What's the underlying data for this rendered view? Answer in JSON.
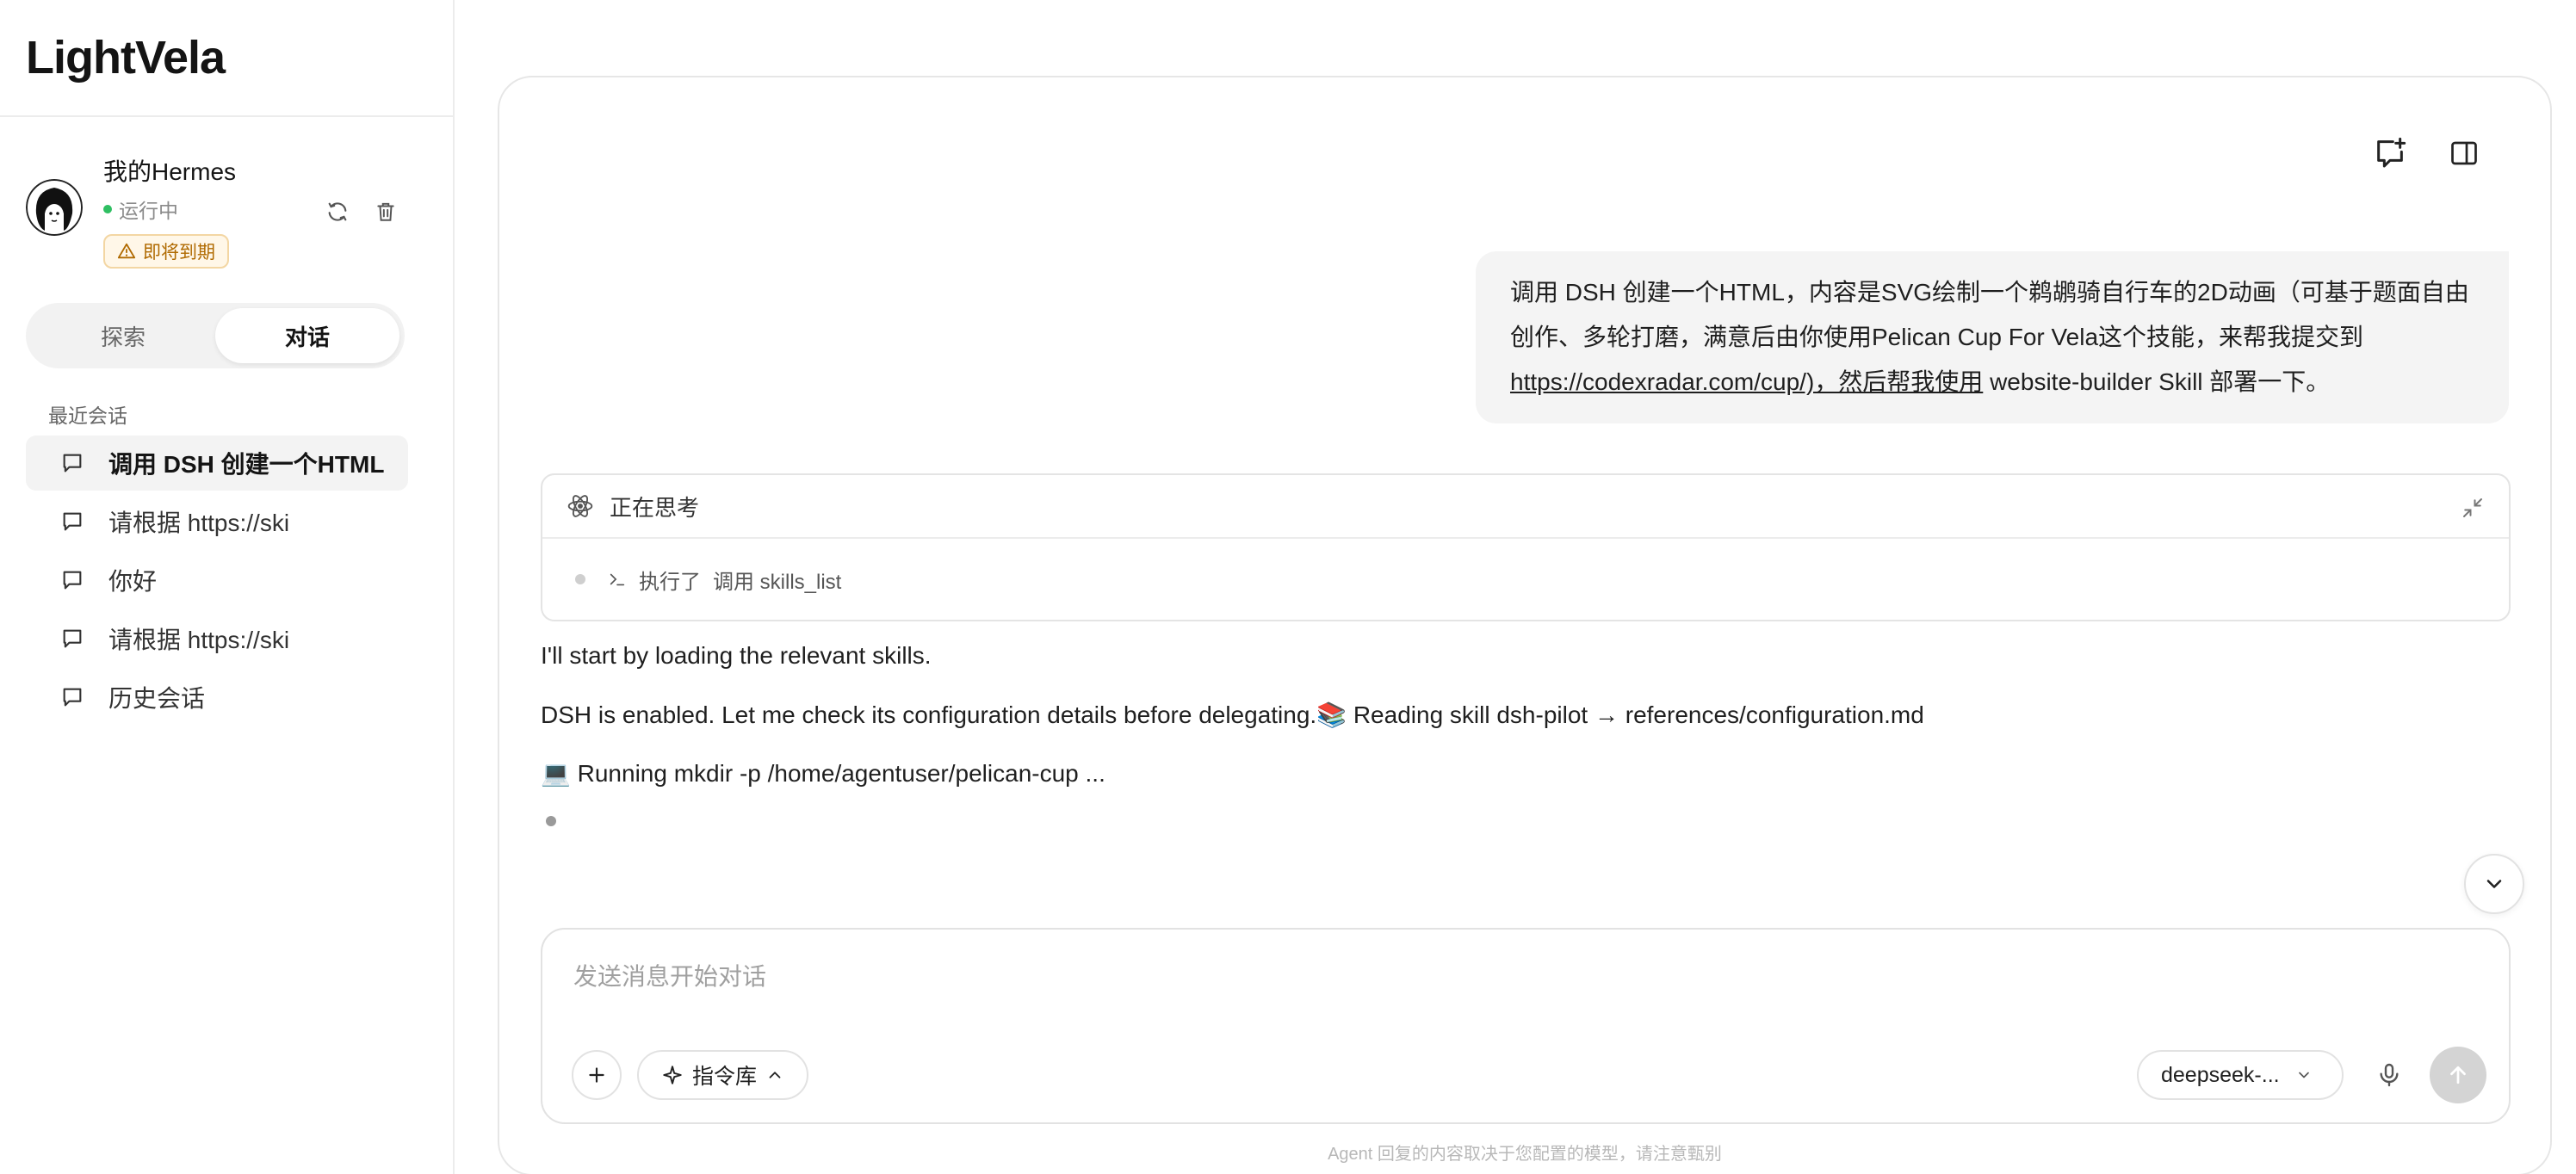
{
  "app": {
    "brand": "LightVela"
  },
  "agent": {
    "name": "我的Hermes",
    "status": "运行中",
    "badge": "即将到期"
  },
  "mode_tabs": [
    {
      "label": "探索",
      "active": false
    },
    {
      "label": "对话",
      "active": true
    }
  ],
  "sidebar": {
    "recent_title": "最近会话",
    "conversations": [
      {
        "label": "调用 DSH 创建一个HTML",
        "active": true
      },
      {
        "label": "请根据 https://ski",
        "active": false
      },
      {
        "label": "你好",
        "active": false
      },
      {
        "label": "请根据 https://ski",
        "active": false
      },
      {
        "label": "历史会话",
        "active": false
      }
    ]
  },
  "chat": {
    "user_message": {
      "text_1": "调用 DSH 创建一个HTML，内容是SVG绘制一个鹈鹕骑自行车的2D动画（可基于题面自由创作、多轮打磨，满意后由你使用Pelican Cup For Vela这个技能，来帮我提交到",
      "link": "https://codexradar.com/cup/)，然后帮我使用",
      "text_2": " website-builder Skill 部署一下。"
    },
    "thinking": {
      "title": "正在思考",
      "step_prefix": "执行了",
      "step_text": "调用 skills_list"
    },
    "replies": [
      "I'll start by loading the relevant skills.",
      "DSH is enabled. Let me check its configuration details before delegating.📚 Reading skill dsh-pilot → references/configuration.md",
      "💻 Running mkdir -p /home/agentuser/pelican-cup ..."
    ]
  },
  "composer": {
    "placeholder": "发送消息开始对话",
    "command_label": "指令库",
    "model_label": "deepseek-..."
  },
  "footer": {
    "disclaimer": "Agent 回复的内容取决于您配置的模型，请注意甄别"
  },
  "colors": {
    "status_green": "#2fbf62",
    "badge_text": "#b06a00",
    "badge_bg": "#fff7e8"
  }
}
